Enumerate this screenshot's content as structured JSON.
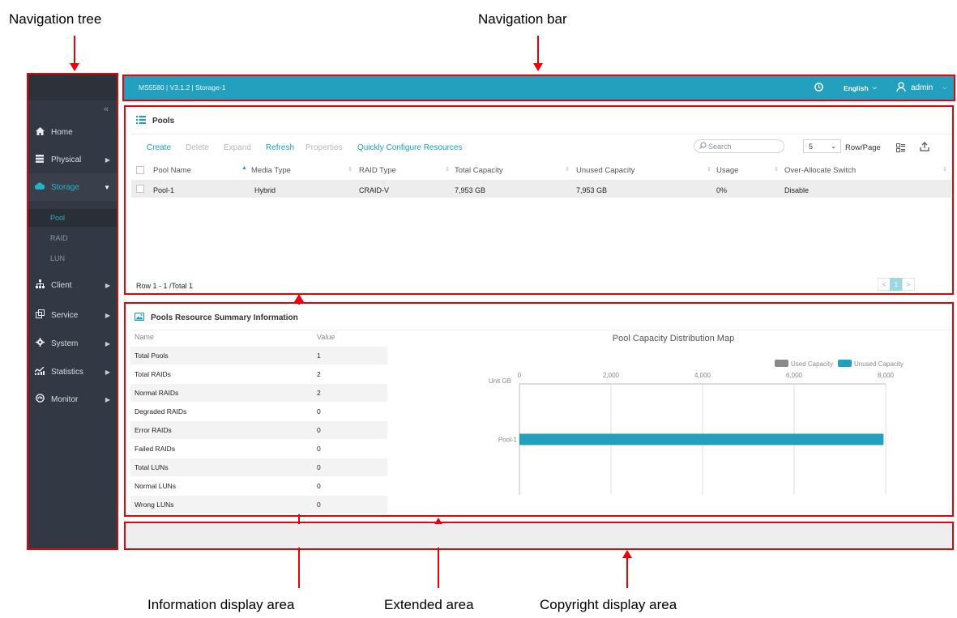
{
  "callouts": {
    "nav_tree": "Navigation tree",
    "nav_bar": "Navigation bar",
    "info_area": "Information display area",
    "extended_area": "Extended area",
    "copyright_area": "Copyright display area"
  },
  "sidebar": {
    "collapse": "«",
    "items": [
      {
        "label": "Home",
        "icon": "home-icon"
      },
      {
        "label": "Physical",
        "icon": "server-icon"
      },
      {
        "label": "Storage",
        "icon": "cloud-icon"
      },
      {
        "label": "Client",
        "icon": "network-icon"
      },
      {
        "label": "Service",
        "icon": "service-icon"
      },
      {
        "label": "System",
        "icon": "gear-icon"
      },
      {
        "label": "Statistics",
        "icon": "statistics-icon"
      },
      {
        "label": "Monitor",
        "icon": "monitor-icon"
      }
    ],
    "storage_sub": [
      "Pool",
      "RAID",
      "LUN"
    ]
  },
  "topbar": {
    "breadcrumb": "MS5580 | V3.1.2 | Storage-1",
    "language": "English",
    "user": "admin",
    "clock_icon": "clock-icon",
    "user_icon": "user-icon"
  },
  "pools": {
    "title": "Pools",
    "toolbar": {
      "create": "Create",
      "delete": "Delete",
      "expand": "Expand",
      "refresh": "Refresh",
      "properties": "Properties",
      "quick": "Quickly Configure Resources"
    },
    "search_placeholder": "Search",
    "rows_per_page": "5",
    "rows_label": "Row/Page",
    "columns": [
      "Pool Name",
      "Media Type",
      "RAID Type",
      "Total Capacity",
      "Unused Capacity",
      "Usage",
      "Over-Allocate Switch"
    ],
    "rows": [
      {
        "name": "Pool-1",
        "media": "Hybrid",
        "raid": "CRAID-V",
        "total": "7,953 GB",
        "unused": "7,953 GB",
        "usage": "0%",
        "over": "Disable"
      }
    ],
    "footer": "Row 1 - 1 /Total 1",
    "page": "1",
    "prev": "<",
    "next": ">"
  },
  "summary": {
    "title": "Pools Resource Summary Information",
    "name_header": "Name",
    "value_header": "Value",
    "rows": [
      {
        "name": "Total Pools",
        "value": "1"
      },
      {
        "name": "Total RAIDs",
        "value": "2"
      },
      {
        "name": "Normal RAIDs",
        "value": "2"
      },
      {
        "name": "Degraded RAIDs",
        "value": "0"
      },
      {
        "name": "Error RAIDs",
        "value": "0"
      },
      {
        "name": "Failed RAIDs",
        "value": "0"
      },
      {
        "name": "Total LUNs",
        "value": "0"
      },
      {
        "name": "Normal LUNs",
        "value": "0"
      },
      {
        "name": "Wrong LUNs",
        "value": "0"
      }
    ]
  },
  "chart_data": {
    "type": "bar",
    "orientation": "horizontal",
    "title": "Pool Capacity Distribution Map",
    "unit_label": "Unit GB",
    "categories": [
      "Pool-1"
    ],
    "series": [
      {
        "name": "Used Capacity",
        "values": [
          0
        ],
        "color": "#8a8a8a"
      },
      {
        "name": "Unused Capacity",
        "values": [
          7953
        ],
        "color": "#22a0be"
      }
    ],
    "xlim": [
      0,
      8000
    ],
    "ticks": [
      0,
      2000,
      4000,
      6000,
      8000
    ],
    "tick_labels": [
      "0",
      "2,000",
      "4,000",
      "6,000",
      "8,000"
    ],
    "legend": "top-right",
    "grid": true
  },
  "colors": {
    "accent": "#22a0be",
    "annotation": "#e8000b",
    "sidebar": "#333944"
  }
}
